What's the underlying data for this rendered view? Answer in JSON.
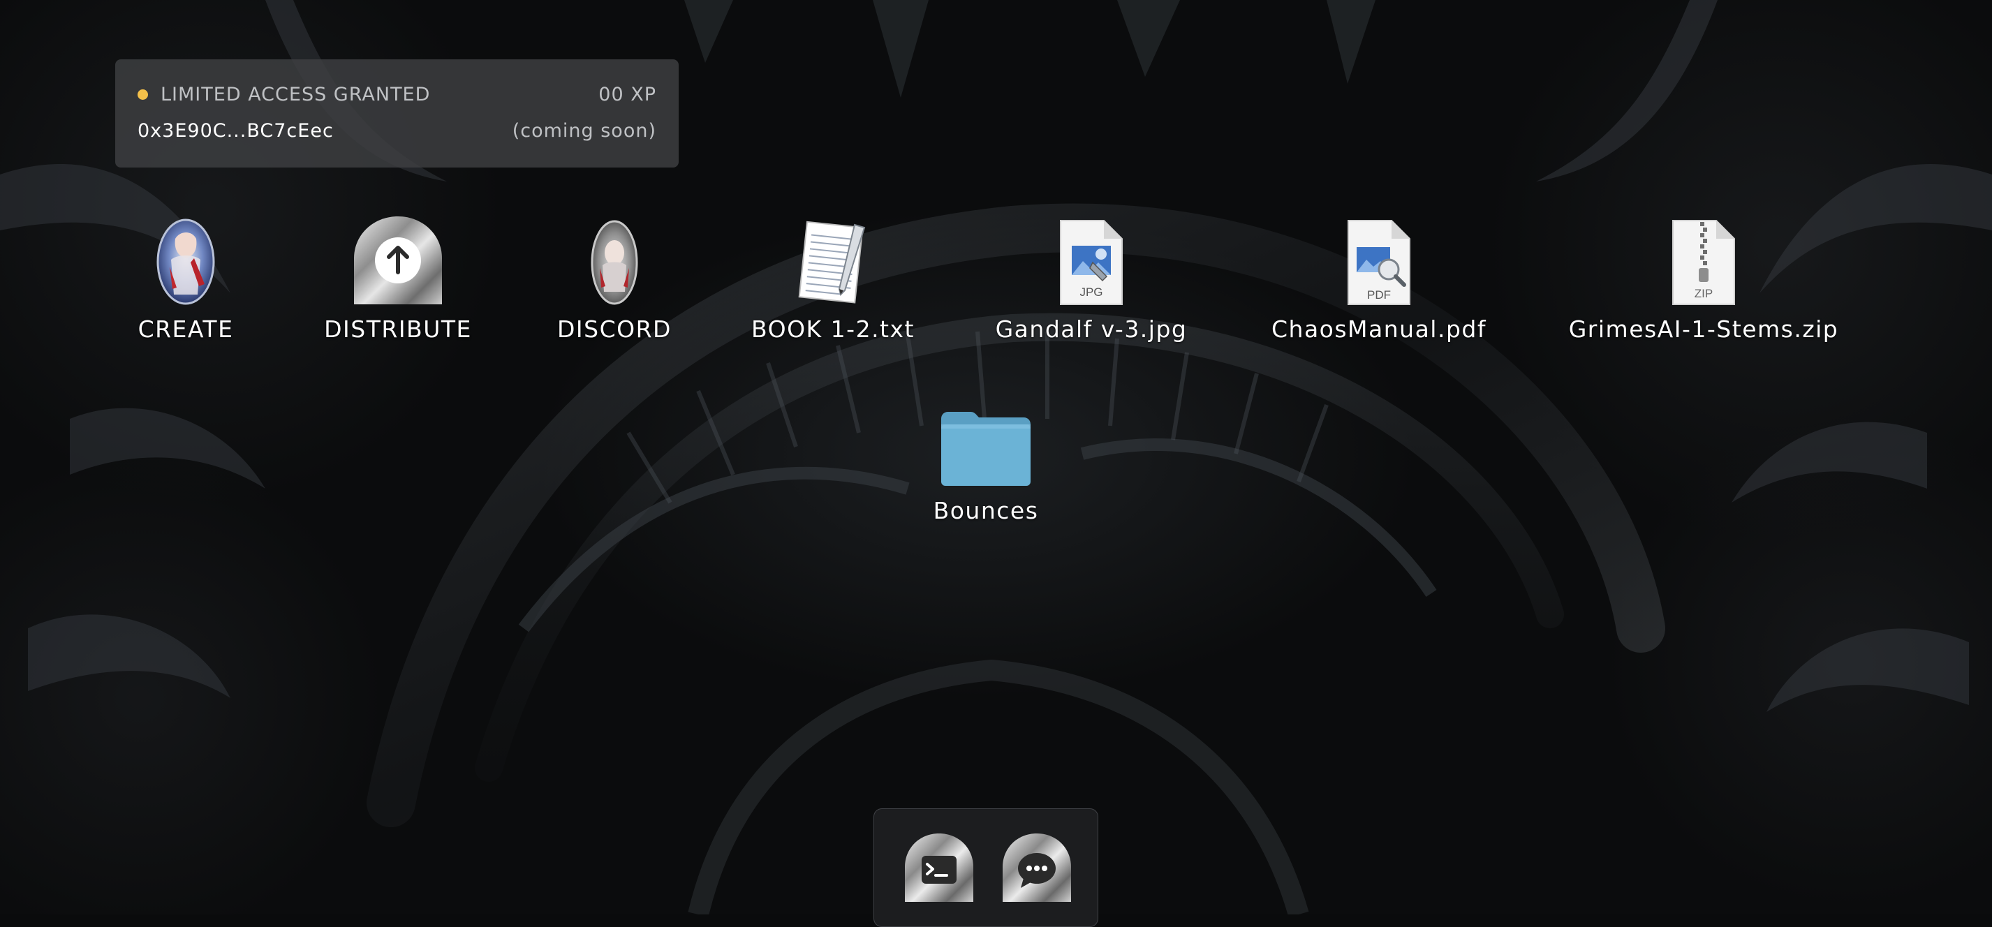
{
  "status": {
    "access_text": "LIMITED ACCESS GRANTED",
    "xp_text": "00 XP",
    "wallet_address": "0x3E90C...BC7cEec",
    "coming_soon_text": "(coming soon)",
    "indicator_color": "#f4c04a"
  },
  "desktop": {
    "icons": [
      {
        "label": "CREATE",
        "icon": "character-portrait-icon"
      },
      {
        "label": "DISTRIBUTE",
        "icon": "upload-arrow-icon"
      },
      {
        "label": "DISCORD",
        "icon": "character-portrait-icon"
      },
      {
        "label": "BOOK 1-2.txt",
        "icon": "text-document-icon"
      },
      {
        "label": "Gandalf v-3.jpg",
        "icon": "jpg-file-icon"
      },
      {
        "label": "ChaosManual.pdf",
        "icon": "pdf-file-icon"
      },
      {
        "label": "GrimesAI-1-Stems.zip",
        "icon": "zip-file-icon"
      },
      {
        "label": "Bounces",
        "icon": "folder-icon"
      }
    ],
    "file_badges": {
      "jpg": "JPG",
      "pdf": "PDF",
      "zip": "ZIP"
    },
    "folder_color": "#6bb3d6"
  },
  "dock": {
    "items": [
      {
        "name": "terminal",
        "icon": "terminal-icon"
      },
      {
        "name": "chat",
        "icon": "chat-bubble-icon"
      }
    ]
  }
}
